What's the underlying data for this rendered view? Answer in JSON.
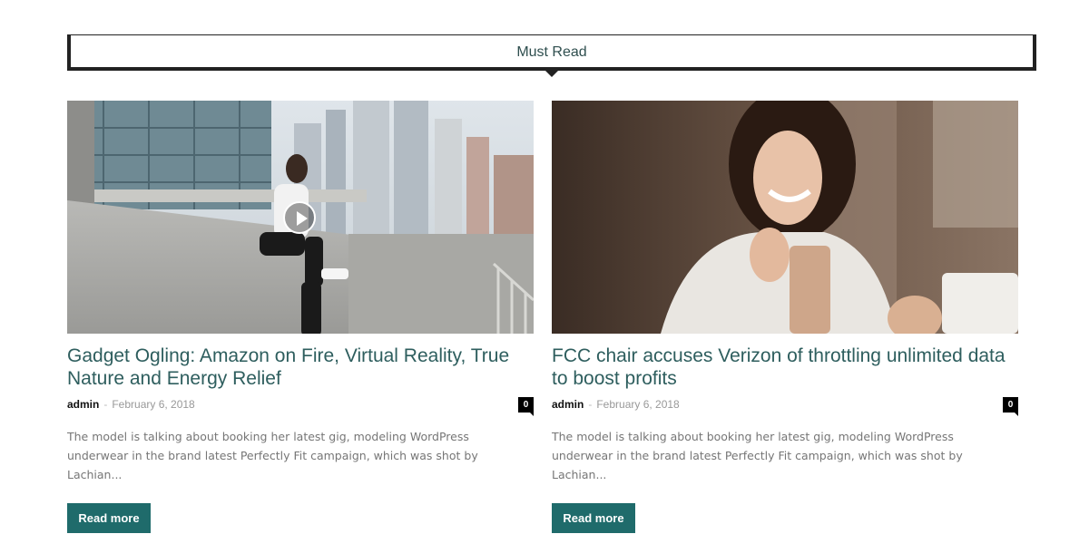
{
  "section": {
    "title": "Must Read"
  },
  "posts": [
    {
      "title": "Gadget Ogling: Amazon on Fire, Virtual Reality, True Nature and Energy Relief",
      "author": "admin",
      "separator": "-",
      "date": "February 6, 2018",
      "comments": "0",
      "excerpt": "The model is talking about booking her latest gig, modeling WordPress underwear in the brand latest Perfectly Fit campaign, which was shot by Lachian...",
      "read_more": "Read more",
      "has_video": true
    },
    {
      "title": "FCC chair accuses Verizon of throttling unlimited data to boost profits",
      "author": "admin",
      "separator": "-",
      "date": "February 6, 2018",
      "comments": "0",
      "excerpt": "The model is talking about booking her latest gig, modeling WordPress underwear in the brand latest Perfectly Fit campaign, which was shot by Lachian...",
      "read_more": "Read more",
      "has_video": false
    }
  ],
  "colors": {
    "accent": "#1f6b6b",
    "title": "#2e5e5e",
    "excerpt": "#767676"
  }
}
